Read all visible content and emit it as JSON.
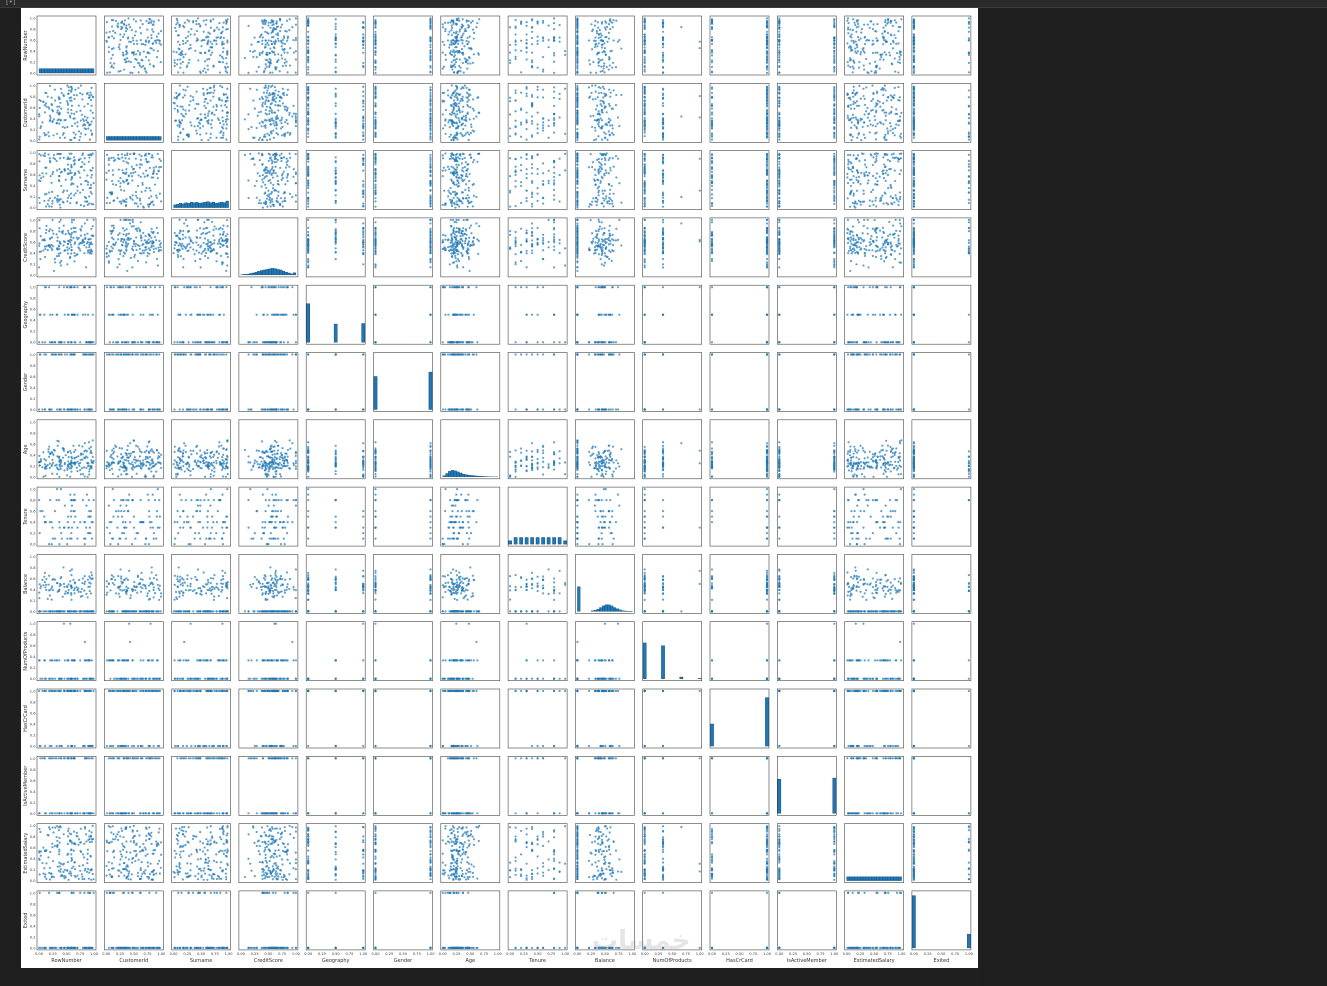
{
  "window": {
    "corner_glyph": "[•]"
  },
  "watermark": "خمسات",
  "colors": {
    "marker": "#1f77b4",
    "marker_light": "#a9c9e4",
    "figure_bg": "#ffffff",
    "page_bg": "#1f1f1f"
  },
  "chart_data": {
    "type": "scatter",
    "subtype": "pairplot",
    "variables": [
      "RowNumber",
      "CustomerId",
      "Surname",
      "CreditScore",
      "Geography",
      "Gender",
      "Age",
      "Tenure",
      "Balance",
      "NumOfProducts",
      "HasCrCard",
      "IsActiveMember",
      "EstimatedSalary",
      "Exited"
    ],
    "y_labels": [
      "RowNumber",
      "CustomerId",
      "Surname",
      "CreditScore",
      "Geography",
      "Gender",
      "Age",
      "Tenure",
      "Balance",
      "NumOfProducts",
      "HasCrCard",
      "IsActiveMember",
      "EstimatedSalary",
      "Exited"
    ],
    "x_labels": [
      "RowNumber",
      "CustomerId",
      "Surname",
      "CreditScore",
      "Geography",
      "Gender",
      "Age",
      "Tenure",
      "Balance",
      "NumOfProducts",
      "HasCrCard",
      "IsActiveMember",
      "EstimatedSalary",
      "Exited"
    ],
    "xlim": [
      0,
      1
    ],
    "ylim": [
      0,
      1
    ],
    "y_ticks": [
      "0.0",
      "0.2",
      "0.4",
      "0.6",
      "0.8",
      "1.0"
    ],
    "x_ticks": [
      "0.00",
      "0.25",
      "0.50",
      "0.75",
      "1.00"
    ],
    "distributions": {
      "RowNumber": {
        "kind": "continuous",
        "spread": "uniform",
        "hist": [
          0.08,
          0.08,
          0.08,
          0.08,
          0.08,
          0.08,
          0.08,
          0.08,
          0.08,
          0.08,
          0.08,
          0.08,
          0.08,
          0.08,
          0.08,
          0.08,
          0.08,
          0.08,
          0.08,
          0.08
        ]
      },
      "CustomerId": {
        "kind": "continuous",
        "spread": "uniform",
        "hist": [
          0.07,
          0.07,
          0.07,
          0.07,
          0.07,
          0.07,
          0.07,
          0.07,
          0.07,
          0.07,
          0.07,
          0.07,
          0.07,
          0.07,
          0.07,
          0.07,
          0.07,
          0.07,
          0.07,
          0.07
        ]
      },
      "Surname": {
        "kind": "continuous",
        "spread": "uniform",
        "hist": [
          0.05,
          0.06,
          0.08,
          0.07,
          0.09,
          0.08,
          0.1,
          0.09,
          0.1,
          0.08,
          0.09,
          0.1,
          0.11,
          0.09,
          0.1,
          0.08,
          0.09,
          0.1,
          0.09,
          0.12
        ]
      },
      "CreditScore": {
        "kind": "continuous",
        "spread": "normal",
        "center": 0.6,
        "sd": 0.19,
        "hist": [
          0.005,
          0.01,
          0.015,
          0.025,
          0.035,
          0.05,
          0.065,
          0.08,
          0.09,
          0.1,
          0.11,
          0.12,
          0.115,
          0.1,
          0.09,
          0.07,
          0.05,
          0.035,
          0.02,
          0.04
        ]
      },
      "Geography": {
        "kind": "discrete",
        "values": [
          0,
          0.5,
          1
        ],
        "hist_bars": [
          {
            "x": 0.0,
            "h": 0.7
          },
          {
            "x": 0.5,
            "h": 0.33
          },
          {
            "x": 1.0,
            "h": 0.34
          }
        ]
      },
      "Gender": {
        "kind": "discrete",
        "values": [
          0,
          1
        ],
        "hist_bars": [
          {
            "x": 0.0,
            "h": 0.6
          },
          {
            "x": 1.0,
            "h": 0.68
          }
        ]
      },
      "Age": {
        "kind": "continuous",
        "spread": "skewed",
        "center": 0.28,
        "sd": 0.15,
        "hist": [
          0.02,
          0.06,
          0.1,
          0.12,
          0.11,
          0.09,
          0.07,
          0.05,
          0.04,
          0.03,
          0.025,
          0.02,
          0.015,
          0.01,
          0.008,
          0.006,
          0.004,
          0.003,
          0.002,
          0.002
        ]
      },
      "Tenure": {
        "kind": "discrete",
        "values": [
          0,
          0.1,
          0.2,
          0.3,
          0.4,
          0.5,
          0.6,
          0.7,
          0.8,
          0.9,
          1.0
        ],
        "hist_bars": [
          {
            "x": 0.0,
            "h": 0.06
          },
          {
            "x": 0.1,
            "h": 0.12
          },
          {
            "x": 0.2,
            "h": 0.12
          },
          {
            "x": 0.3,
            "h": 0.12
          },
          {
            "x": 0.4,
            "h": 0.12
          },
          {
            "x": 0.5,
            "h": 0.12
          },
          {
            "x": 0.6,
            "h": 0.12
          },
          {
            "x": 0.7,
            "h": 0.12
          },
          {
            "x": 0.8,
            "h": 0.12
          },
          {
            "x": 0.9,
            "h": 0.12
          },
          {
            "x": 1.0,
            "h": 0.06
          }
        ]
      },
      "Balance": {
        "kind": "mixed",
        "zero_spike": 0.45,
        "center": 0.48,
        "sd": 0.12,
        "hist": [
          0.45,
          0.0,
          0.0,
          0.0,
          0.0,
          0.01,
          0.02,
          0.04,
          0.07,
          0.1,
          0.12,
          0.12,
          0.1,
          0.07,
          0.05,
          0.03,
          0.015,
          0.007,
          0.003,
          0.001
        ]
      },
      "NumOfProducts": {
        "kind": "discrete",
        "values": [
          0,
          0.333,
          0.667,
          1.0
        ],
        "hist_bars": [
          {
            "x": 0.0,
            "h": 0.65
          },
          {
            "x": 0.333,
            "h": 0.6
          },
          {
            "x": 0.667,
            "h": 0.03
          },
          {
            "x": 1.0,
            "h": 0.005
          }
        ]
      },
      "HasCrCard": {
        "kind": "discrete",
        "values": [
          0,
          1
        ],
        "hist_bars": [
          {
            "x": 0.0,
            "h": 0.4
          },
          {
            "x": 1.0,
            "h": 0.88
          }
        ]
      },
      "IsActiveMember": {
        "kind": "discrete",
        "values": [
          0,
          1
        ],
        "hist_bars": [
          {
            "x": 0.0,
            "h": 0.62
          },
          {
            "x": 1.0,
            "h": 0.64
          }
        ]
      },
      "EstimatedSalary": {
        "kind": "continuous",
        "spread": "uniform",
        "hist": [
          0.07,
          0.07,
          0.07,
          0.07,
          0.07,
          0.07,
          0.07,
          0.07,
          0.07,
          0.07,
          0.07,
          0.07,
          0.07,
          0.07,
          0.07,
          0.07,
          0.07,
          0.07,
          0.07,
          0.07
        ]
      },
      "Exited": {
        "kind": "discrete",
        "values": [
          0,
          1
        ],
        "hist_bars": [
          {
            "x": 0.0,
            "h": 0.95
          },
          {
            "x": 1.0,
            "h": 0.25
          }
        ]
      }
    }
  }
}
